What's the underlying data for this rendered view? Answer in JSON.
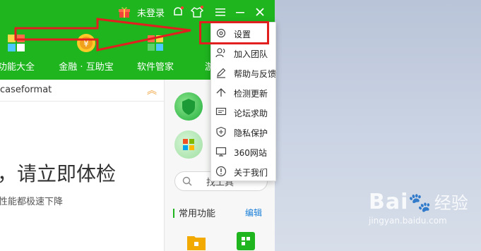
{
  "titlebar": {
    "login_label": "未登录"
  },
  "nav": [
    {
      "label": "功能大全"
    },
    {
      "label": "金融 · 互助宝"
    },
    {
      "label": "软件管家"
    },
    {
      "label": "游"
    }
  ],
  "main": {
    "breadcrumb": "caseformat",
    "headline": "，请立即体检",
    "subline": "性能都极速下降"
  },
  "right_panel": {
    "search_placeholder": "找工具",
    "common_label": "常用功能",
    "edit_label": "编辑"
  },
  "menu": {
    "items": [
      {
        "label": "设置",
        "icon": "gear-icon"
      },
      {
        "label": "加入团队",
        "icon": "users-icon"
      },
      {
        "label": "帮助与反馈",
        "icon": "pencil-icon"
      },
      {
        "label": "检测更新",
        "icon": "upload-icon"
      },
      {
        "label": "论坛求助",
        "icon": "chat-icon"
      },
      {
        "label": "隐私保护",
        "icon": "shield-icon"
      },
      {
        "label": "360网站",
        "icon": "monitor-icon"
      },
      {
        "label": "关于我们",
        "icon": "info-icon"
      }
    ]
  },
  "watermark": {
    "brand": "Bai",
    "brand_tail": "经验",
    "url": "jingyan.baidu.com"
  },
  "colors": {
    "brand_green": "#1fb51f",
    "annotation_red": "#e21f1f",
    "link_blue": "#1a7ed8"
  }
}
